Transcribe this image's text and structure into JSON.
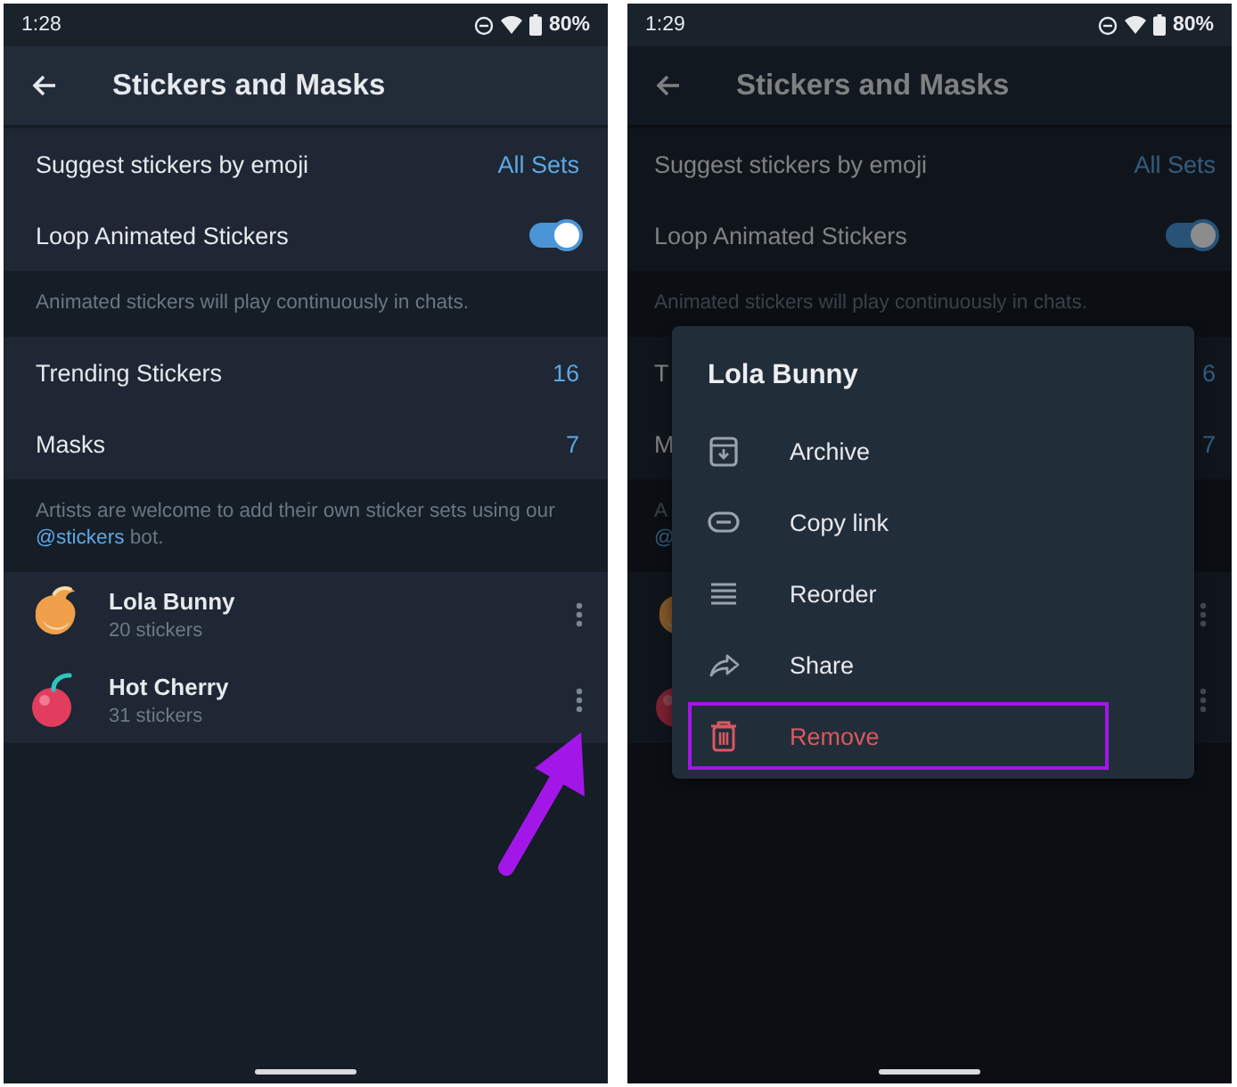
{
  "screens": [
    {
      "dimmed": false,
      "pointer_arrow": true,
      "status_bar": {
        "time": "1:28",
        "battery": "80%"
      },
      "header": {
        "title": "Stickers and Masks"
      },
      "sections": [
        {
          "kind": "rows",
          "rows": [
            {
              "kind": "value",
              "label": "Suggest stickers by emoji",
              "value": "All Sets"
            },
            {
              "kind": "toggle",
              "label": "Loop Animated Stickers",
              "on": true
            }
          ]
        },
        {
          "kind": "note",
          "text": "Animated stickers will play continuously in chats."
        },
        {
          "kind": "rows",
          "rows": [
            {
              "kind": "value",
              "label": "Trending Stickers",
              "value": "16"
            },
            {
              "kind": "value",
              "label": "Masks",
              "value": "7"
            }
          ]
        },
        {
          "kind": "note",
          "text": "Artists are welcome to add their own sticker sets using our",
          "link": "@stickers",
          "after": "bot."
        },
        {
          "kind": "stickers",
          "rows": [
            {
              "kind": "sticker",
              "name": "Lola Bunny",
              "count": "20 stickers"
            },
            {
              "kind": "sticker",
              "name": "Hot Cherry",
              "count": "31 stickers"
            }
          ]
        }
      ]
    },
    {
      "dimmed": true,
      "pointer_arrow": false,
      "status_bar": {
        "time": "1:29",
        "battery": "80%"
      },
      "header": {
        "title": "Stickers and Masks"
      },
      "sections": [
        {
          "kind": "rows",
          "rows": [
            {
              "kind": "value",
              "label": "Suggest stickers by emoji",
              "value": "All Sets"
            },
            {
              "kind": "toggle",
              "label": "Loop Animated Stickers",
              "on": true
            }
          ]
        },
        {
          "kind": "note",
          "text": "Animated stickers will play continuously in chats."
        },
        {
          "kind": "rows",
          "rows": [
            {
              "kind": "value",
              "label": "T",
              "value": "6"
            },
            {
              "kind": "value",
              "label": "M",
              "value": "7"
            }
          ]
        },
        {
          "kind": "note",
          "text": "A",
          "link": "@"
        },
        {
          "kind": "stickers",
          "rows": [
            {
              "kind": "sticker"
            },
            {
              "kind": "sticker"
            }
          ]
        }
      ],
      "menu": {
        "title": "Lola Bunny",
        "items": [
          {
            "label": "Archive",
            "danger": false,
            "highlighted": false
          },
          {
            "label": "Copy link",
            "danger": false,
            "highlighted": false
          },
          {
            "label": "Reorder",
            "danger": false,
            "highlighted": false
          },
          {
            "label": "Share",
            "danger": false,
            "highlighted": false
          },
          {
            "label": "Remove",
            "danger": true,
            "highlighted": true
          }
        ]
      }
    }
  ]
}
